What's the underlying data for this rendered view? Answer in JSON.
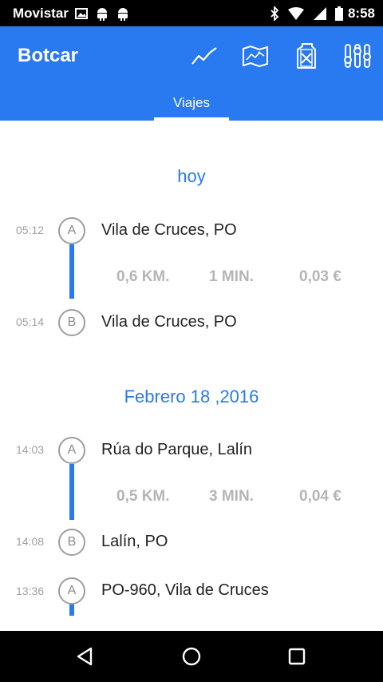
{
  "status_bar": {
    "carrier": "Movistar",
    "time": "8:58"
  },
  "app_bar": {
    "title": "Botcar",
    "actions": [
      {
        "name": "stats-action",
        "icon": "line-chart-icon"
      },
      {
        "name": "map-action",
        "icon": "map-icon"
      },
      {
        "name": "fuel-action",
        "icon": "fuel-can-icon"
      },
      {
        "name": "settings-action",
        "icon": "sliders-icon"
      }
    ]
  },
  "tabs": [
    {
      "label": "Viajes",
      "selected": true
    }
  ],
  "colors": {
    "primary": "#2979f0",
    "stat_text": "#b5b5b5",
    "time_text": "#a0a0a0"
  },
  "trip_days": [
    {
      "header": "hoy",
      "trips": [
        {
          "start": {
            "time": "05:12",
            "marker": "A",
            "place": "Vila de Cruces, PO"
          },
          "distance": "0,6 KM.",
          "duration": "1 MIN.",
          "cost": "0,03 €",
          "end": {
            "time": "05:14",
            "marker": "B",
            "place": "Vila de Cruces, PO"
          }
        }
      ]
    },
    {
      "header": "Febrero 18 ,2016",
      "trips": [
        {
          "start": {
            "time": "14:03",
            "marker": "A",
            "place": "Rúa do Parque, Lalín"
          },
          "distance": "0,5 KM.",
          "duration": "3 MIN.",
          "cost": "0,04 €",
          "end": {
            "time": "14:08",
            "marker": "B",
            "place": "Lalín, PO"
          }
        },
        {
          "start": {
            "time": "13:36",
            "marker": "A",
            "place": "PO-960, Vila de Cruces"
          }
        }
      ]
    }
  ]
}
